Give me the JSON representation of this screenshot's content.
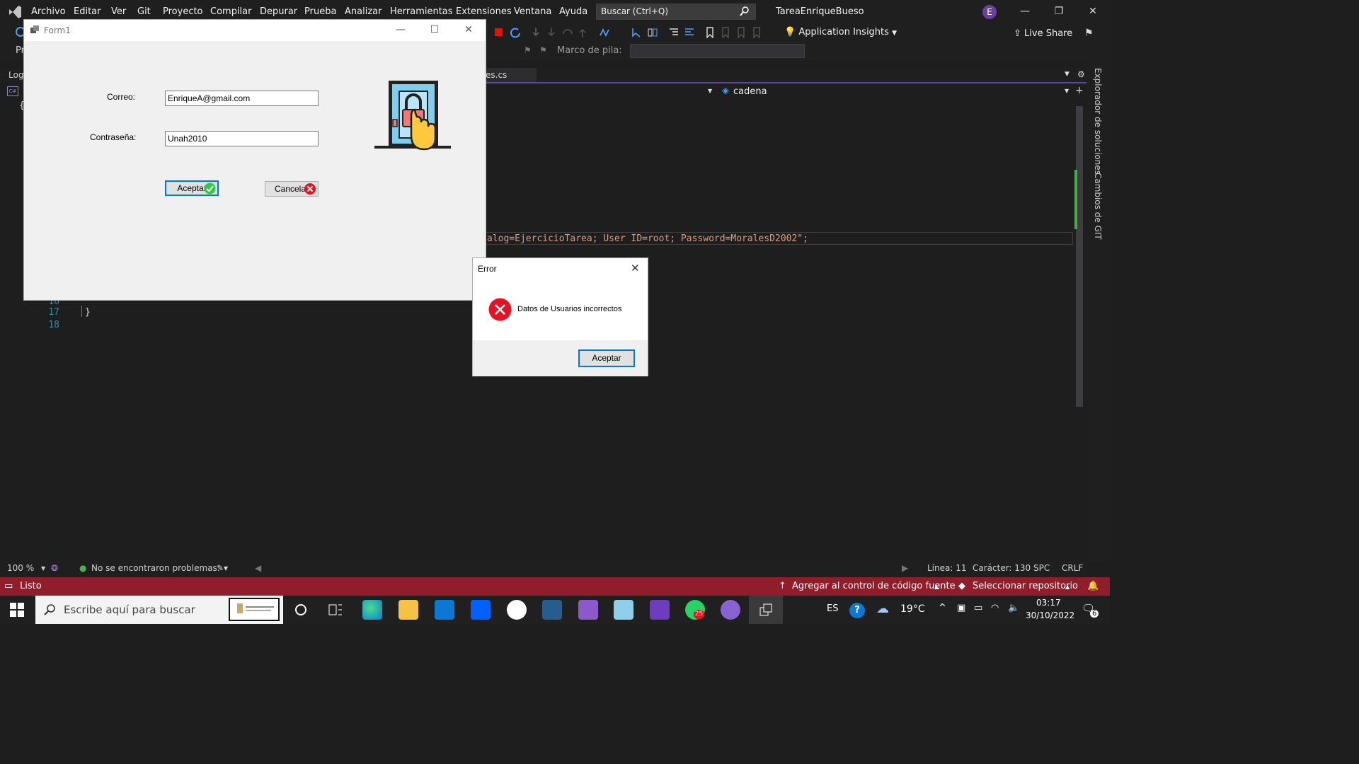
{
  "vs": {
    "menu": [
      "Archivo",
      "Editar",
      "Ver",
      "Git",
      "Proyecto",
      "Compilar",
      "Depurar",
      "Prueba",
      "Analizar",
      "Herramientas",
      "Extensiones",
      "Ventana",
      "Ayuda"
    ],
    "search_placeholder": "Buscar (Ctrl+Q)",
    "solution_title": "TareaEnriqueBueso",
    "avatar_letter": "E",
    "app_insights": "Application Insights",
    "live_share": "Live Share",
    "marco_label": "Marco de pila:",
    "left_stub_pr": "Pr",
    "left_stub_log": "Log",
    "tab_file": "es.cs",
    "nav_member": "cadena",
    "code_line": "alog=EjercicioTarea; User ID=root; Password=MoralesD2002\";",
    "line_numbers": [
      "16",
      "17",
      "18"
    ],
    "brace_17": "}",
    "side_panel": [
      "Explorador de soluciones",
      "Cambios de GIT"
    ],
    "zoom": "100 %",
    "problems": "No se encontraron problemas.",
    "line_info": "Línea: 11",
    "char_info": "Carácter: 130",
    "spc": "SPC",
    "crlf": "CRLF",
    "status_ready": "Listo",
    "status_source": "Agregar al control de código fuente",
    "status_repo": "Seleccionar repositorio"
  },
  "form1": {
    "title": "Form1",
    "correo_label": "Correo:",
    "correo_value": "EnriqueA@gmail.com",
    "pass_label": "Contraseña:",
    "pass_value": "Unah2010",
    "accept_label": "Aceptar",
    "cancel_label": "Cancelar"
  },
  "error_dialog": {
    "title": "Error",
    "message": "Datos de Usuarios incorrectos",
    "ok_label": "Aceptar"
  },
  "taskbar": {
    "search_placeholder": "Escribe aquí para buscar",
    "lang": "ES",
    "temperature": "19°C",
    "time": "03:17",
    "date": "30/10/2022",
    "whatsapp_badge": "25",
    "notif_count": "6"
  },
  "colors": {
    "vs_bg": "#1e1e1e",
    "status_bar": "#8f1d2c",
    "accent_purple": "#5b4a9e",
    "error_red": "#e81123",
    "ok_green": "#2ecc40"
  }
}
